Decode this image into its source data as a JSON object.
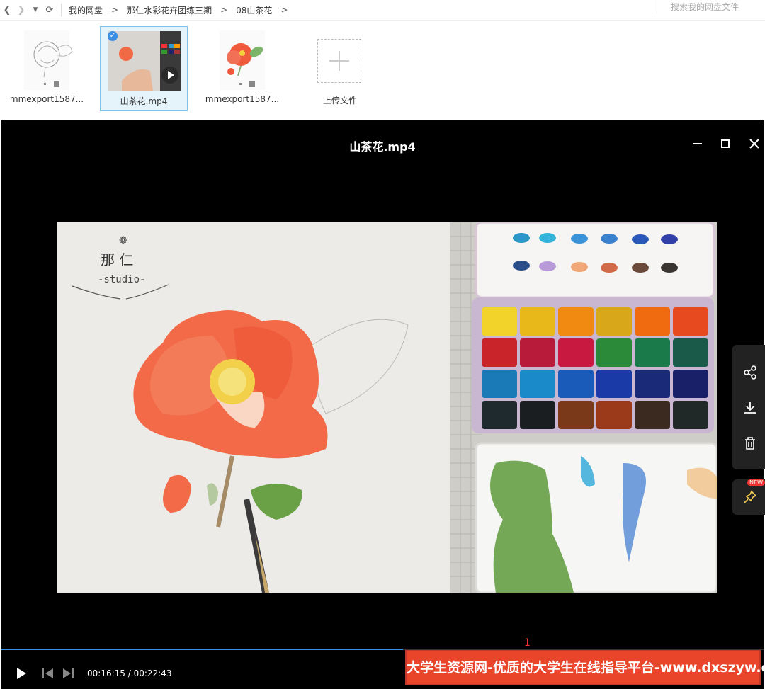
{
  "nav": {
    "breadcrumbs": [
      "我的网盘",
      "那仁水彩花卉团练三期",
      "08山茶花"
    ],
    "search_placeholder": "搜索我的网盘文件"
  },
  "files": [
    {
      "name": "mmexport1587...",
      "type": "image",
      "selected": false
    },
    {
      "name": "山茶花.mp4",
      "type": "video",
      "selected": true
    },
    {
      "name": "mmexport1587...",
      "type": "image",
      "selected": false
    },
    {
      "name": "上传文件",
      "type": "upload",
      "selected": false
    }
  ],
  "player": {
    "title": "山茶花.mp4",
    "time_display": "00:16:15 / 00:22:43",
    "progress": 0.527,
    "studio_brand": "那 仁",
    "studio_sub": "-studio-",
    "badge_new": "NEW",
    "marker": "1"
  },
  "watermark": "大学生资源网-优质的大学生在线指导平台-www.dxszyw.cn",
  "colors": {
    "accent": "#3a8ee6",
    "select_bg": "#e5f3fb",
    "watermark_bg": "#e8452b"
  }
}
